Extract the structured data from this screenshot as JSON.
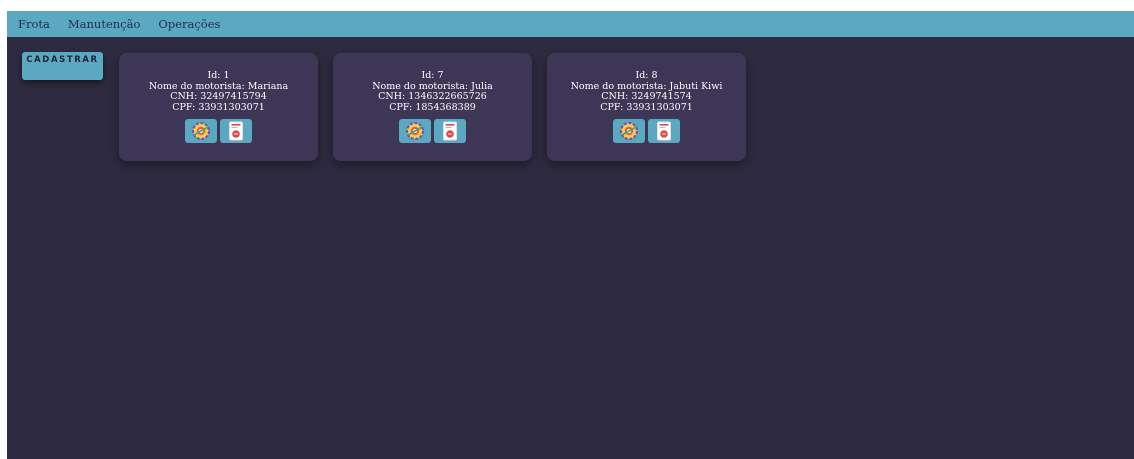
{
  "navbar": {
    "links": [
      "Frota",
      "Manutenção",
      "Operações"
    ]
  },
  "cadastrar_label": "CADASTRAR",
  "drivers": [
    {
      "id_text": "Id: 1",
      "name_text": "Nome do motorista: Mariana",
      "cnh_text": "CNH: 32497415794",
      "cpf_text": "CPF: 33931303071"
    },
    {
      "id_text": "Id: 7",
      "name_text": "Nome do motorista: Julia",
      "cnh_text": "CNH: 1346322665726",
      "cpf_text": "CPF: 1854368389"
    },
    {
      "id_text": "Id: 8",
      "name_text": "Nome do motorista: Jabuti Kiwi",
      "cnh_text": "CNH: 3249741574",
      "cpf_text": "CPF: 33931303071"
    }
  ],
  "icons": {
    "edit": "gear-edit-icon",
    "delete": "delete-document-icon"
  },
  "colors": {
    "navbar": "#5aa9c1",
    "background": "#2e2a40",
    "card": "#3e3657",
    "button": "#5aa9c1"
  }
}
